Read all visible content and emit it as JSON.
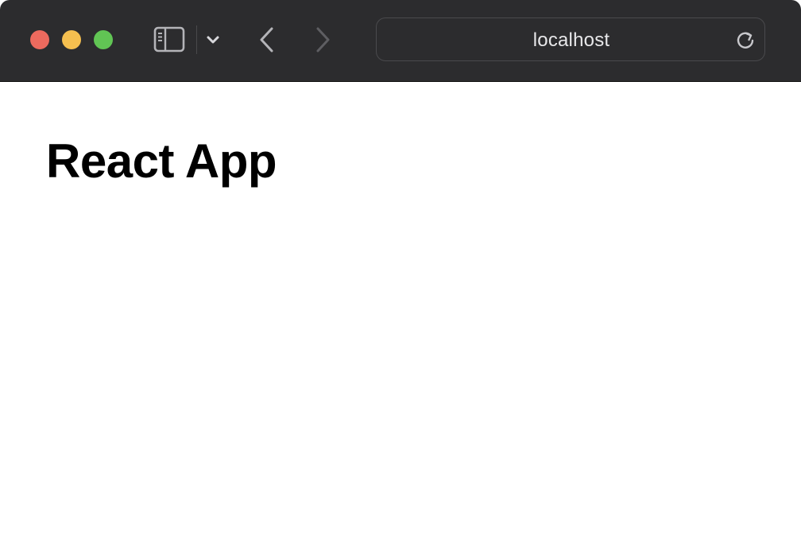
{
  "browser": {
    "address_bar": {
      "text": "localhost"
    },
    "icons": {
      "sidebar": "sidebar-icon",
      "dropdown": "chevron-down-icon",
      "back": "chevron-left-icon",
      "forward": "chevron-right-icon",
      "reload": "reload-icon"
    },
    "traffic_lights": {
      "close": "#ed6a5e",
      "minimize": "#f5bf4f",
      "zoom": "#61c554"
    },
    "toolbar_color": "#2c2c2e"
  },
  "page": {
    "heading": "React App"
  }
}
